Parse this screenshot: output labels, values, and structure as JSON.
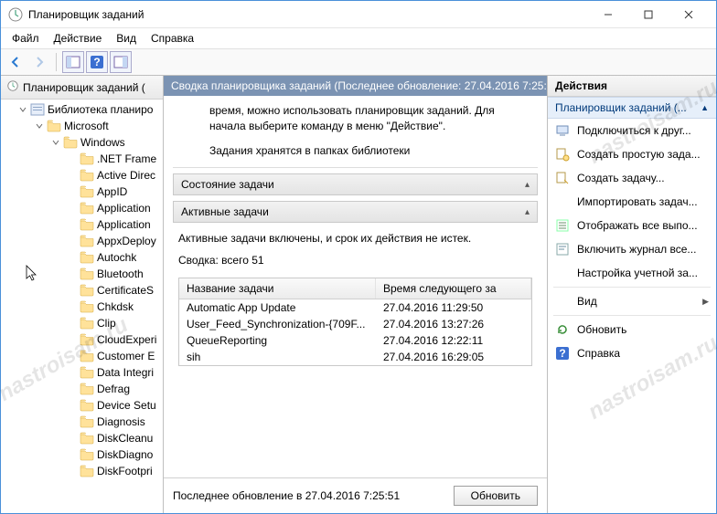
{
  "window": {
    "title": "Планировщик заданий"
  },
  "menu": {
    "file": "Файл",
    "action": "Действие",
    "view": "Вид",
    "help": "Справка"
  },
  "tree": {
    "root": "Планировщик заданий (",
    "library": "Библиотека планиро",
    "microsoft": "Microsoft",
    "windows": "Windows",
    "children": [
      ".NET Frame",
      "Active Direc",
      "AppID",
      "Application",
      "Application",
      "AppxDeploy",
      "Autochk",
      "Bluetooth",
      "CertificateS",
      "Chkdsk",
      "Clip",
      "CloudExperi",
      "Customer E",
      "Data Integri",
      "Defrag",
      "Device Setu",
      "Diagnosis",
      "DiskCleanu",
      "DiskDiagno",
      "DiskFootpri"
    ]
  },
  "center": {
    "header": "Сводка планировщика заданий (Последнее обновление: 27.04.2016 7:25:5",
    "intro": "время, можно использовать планировщик заданий. Для начала выберите команду в меню \"Действие\".",
    "intro2": "Задания хранятся в папках библиотеки",
    "section_status": "Состояние задачи",
    "section_active": "Активные задачи",
    "active_note": "Активные задачи включены, и срок их действия не истек.",
    "summary": "Сводка: всего 51",
    "table": {
      "col_name": "Название задачи",
      "col_time": "Время следующего за",
      "rows": [
        {
          "name": "Automatic App Update",
          "time": "27.04.2016 11:29:50"
        },
        {
          "name": "User_Feed_Synchronization-{709F...",
          "time": "27.04.2016 13:27:26"
        },
        {
          "name": "QueueReporting",
          "time": "27.04.2016 12:22:11"
        },
        {
          "name": "sih",
          "time": "27.04.2016 16:29:05"
        }
      ]
    },
    "footer_text": "Последнее обновление в 27.04.2016 7:25:51",
    "refresh_btn": "Обновить"
  },
  "actions": {
    "title": "Действия",
    "subtitle": "Планировщик заданий (...",
    "items": {
      "connect": "Подключиться к друг...",
      "create_simple": "Создать простую зада...",
      "create_task": "Создать задачу...",
      "import_task": "Импортировать задач...",
      "display_running": "Отображать все выпо...",
      "enable_log": "Включить журнал все...",
      "account_settings": "Настройка учетной за...",
      "view": "Вид",
      "refresh": "Обновить",
      "help": "Справка"
    }
  },
  "watermark": "nastroisam.ru"
}
